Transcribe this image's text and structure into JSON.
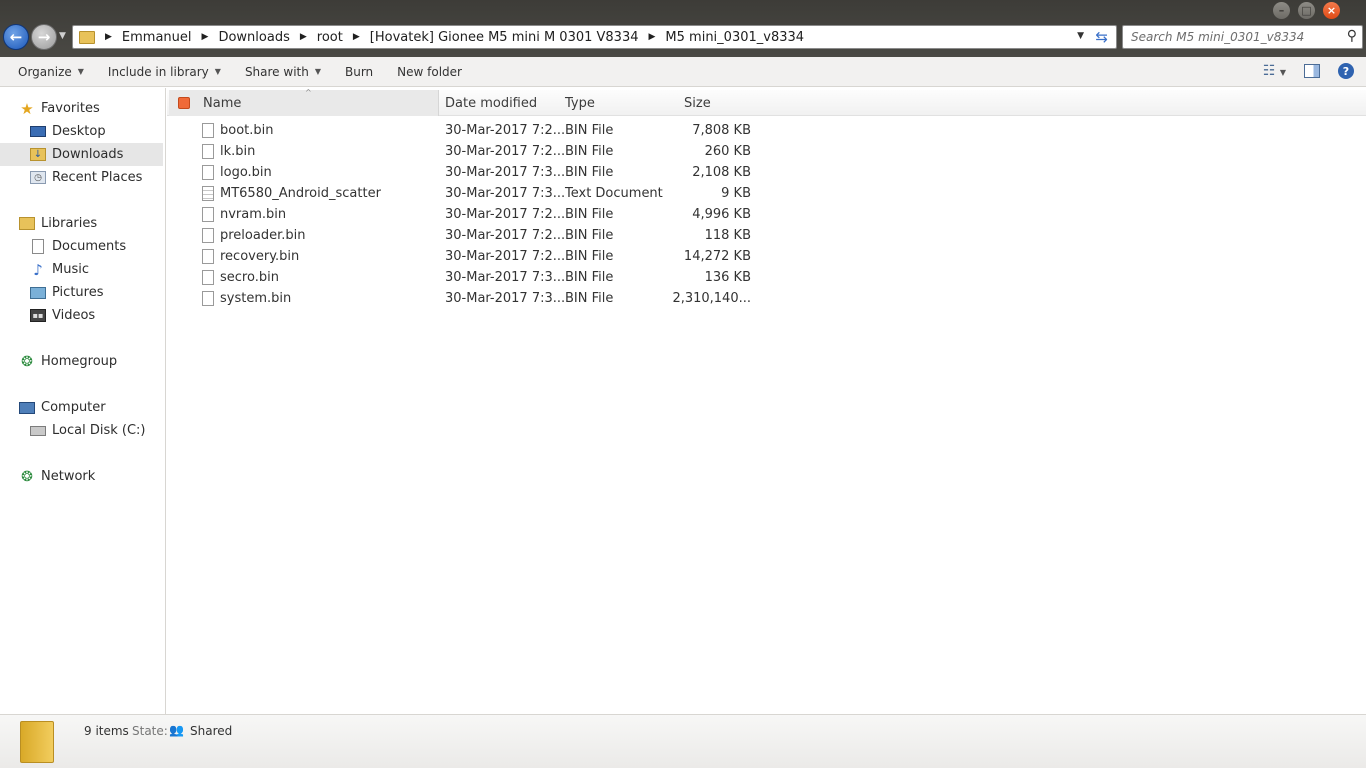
{
  "window": {
    "controls": {
      "minimize": "–",
      "maximize": "□",
      "close": "×"
    }
  },
  "address_bar": {
    "breadcrumbs": [
      "Emmanuel",
      "Downloads",
      "root",
      "[Hovatek] Gionee M5 mini M 0301 V8334",
      "M5 mini_0301_v8334"
    ]
  },
  "search": {
    "placeholder": "Search M5 mini_0301_v8334"
  },
  "toolbar": {
    "organize": "Organize",
    "include_in_library": "Include in library",
    "share_with": "Share with",
    "burn": "Burn",
    "new_folder": "New folder"
  },
  "nav": {
    "favorites": "Favorites",
    "desktop": "Desktop",
    "downloads": "Downloads",
    "recent_places": "Recent Places",
    "libraries": "Libraries",
    "documents": "Documents",
    "music": "Music",
    "pictures": "Pictures",
    "videos": "Videos",
    "homegroup": "Homegroup",
    "computer": "Computer",
    "local_disk": "Local Disk (C:)",
    "network": "Network"
  },
  "columns": {
    "name": "Name",
    "date_modified": "Date modified",
    "type": "Type",
    "size": "Size"
  },
  "files": [
    {
      "name": "boot.bin",
      "date": "30-Mar-2017 7:2...",
      "type": "BIN File",
      "size": "7,808 KB",
      "icon": "file-icon"
    },
    {
      "name": "lk.bin",
      "date": "30-Mar-2017 7:2...",
      "type": "BIN File",
      "size": "260 KB",
      "icon": "file-icon"
    },
    {
      "name": "logo.bin",
      "date": "30-Mar-2017 7:3...",
      "type": "BIN File",
      "size": "2,108 KB",
      "icon": "file-icon"
    },
    {
      "name": "MT6580_Android_scatter",
      "date": "30-Mar-2017 7:3...",
      "type": "Text Document",
      "size": "9 KB",
      "icon": "text-file-icon"
    },
    {
      "name": "nvram.bin",
      "date": "30-Mar-2017 7:2...",
      "type": "BIN File",
      "size": "4,996 KB",
      "icon": "file-icon"
    },
    {
      "name": "preloader.bin",
      "date": "30-Mar-2017 7:2...",
      "type": "BIN File",
      "size": "118 KB",
      "icon": "file-icon"
    },
    {
      "name": "recovery.bin",
      "date": "30-Mar-2017 7:2...",
      "type": "BIN File",
      "size": "14,272 KB",
      "icon": "file-icon"
    },
    {
      "name": "secro.bin",
      "date": "30-Mar-2017 7:3...",
      "type": "BIN File",
      "size": "136 KB",
      "icon": "file-icon"
    },
    {
      "name": "system.bin",
      "date": "30-Mar-2017 7:3...",
      "type": "BIN File",
      "size": "2,310,140...",
      "icon": "file-icon"
    }
  ],
  "details": {
    "item_count": "9 items",
    "state_label": "State:",
    "state_value": "Shared"
  },
  "colors": {
    "accent_blue": "#3a70c9",
    "close_orange": "#df4a16",
    "selected_bg": "#e6e6e6"
  }
}
